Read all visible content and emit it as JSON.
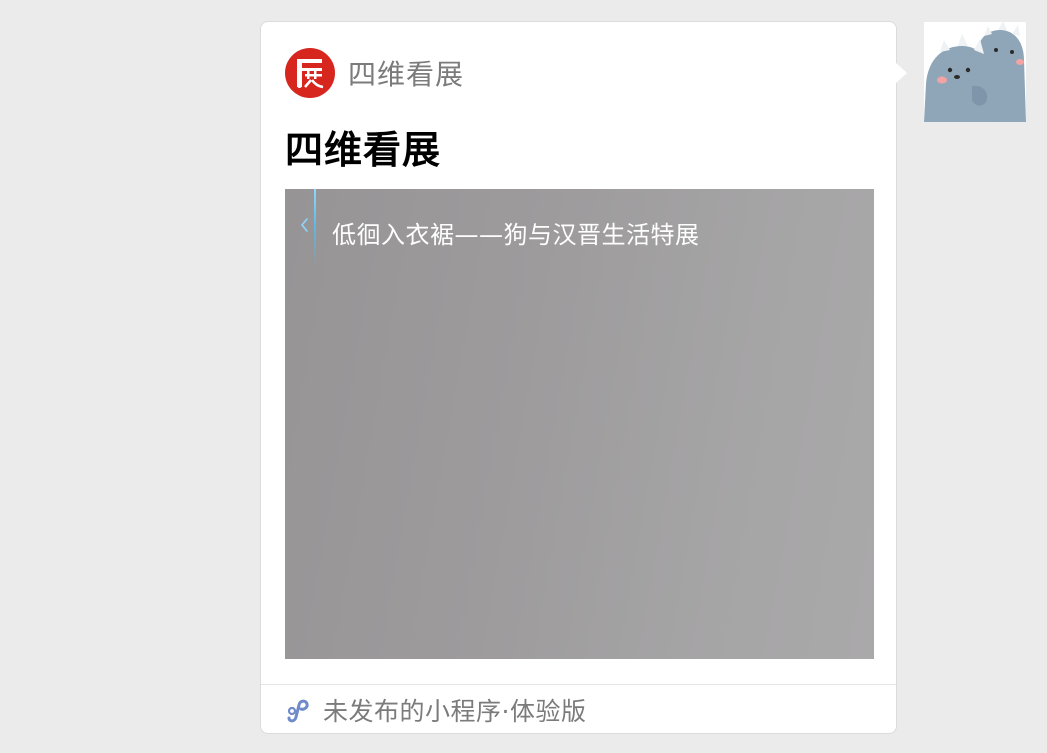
{
  "message_card": {
    "app_name": "四维看展",
    "title": "四维看展",
    "preview": {
      "page_title": "低徊入衣裾——狗与汉晋生活特展",
      "back_icon": "chevron-left-icon"
    },
    "footer": {
      "icon": "mini-program-link-icon",
      "label": "未发布的小程序·体验版"
    }
  },
  "logo": {
    "icon": "exhibition-logo-icon",
    "color": "#d7261e"
  },
  "avatar": {
    "icon": "dinosaur-avatar-icon"
  },
  "colors": {
    "background": "#ebebeb",
    "card": "#ffffff",
    "muted_text": "#7b7b7b",
    "accent_blue": "#6f8ac9"
  }
}
